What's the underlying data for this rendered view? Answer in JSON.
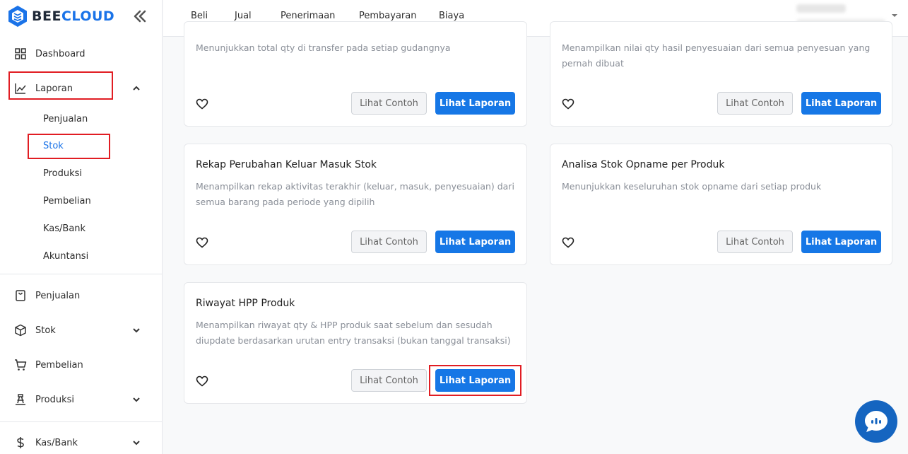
{
  "brand": {
    "name_part1": "BEE",
    "name_part2": "CLOUD"
  },
  "sidebar": {
    "dashboard": "Dashboard",
    "laporan": "Laporan",
    "laporan_sub": [
      "Penjualan",
      "Stok",
      "Produksi",
      "Pembelian",
      "Kas/Bank",
      "Akuntansi"
    ],
    "menu": [
      "Penjualan",
      "Stok",
      "Pembelian",
      "Produksi",
      "Kas/Bank"
    ]
  },
  "topnav": [
    "Beli",
    "Jual",
    "Penerimaan",
    "Pembayaran",
    "Biaya"
  ],
  "cards": [
    {
      "title": "",
      "desc": "Menunjukkan total qty di transfer pada setiap gudangnya"
    },
    {
      "title": "",
      "desc": "Menampilkan nilai qty hasil penyesuaian dari semua penyesuan yang pernah dibuat"
    },
    {
      "title": "Rekap Perubahan Keluar Masuk Stok",
      "desc": "Menampilkan rekap aktivitas terakhir (keluar, masuk, penyesuaian) dari semua barang pada periode yang dipilih"
    },
    {
      "title": "Analisa Stok Opname per Produk",
      "desc": "Menunjukkan keseluruhan stok opname dari setiap produk"
    },
    {
      "title": "Riwayat HPP Produk",
      "desc": "Menampilkan riwayat qty & HPP produk saat sebelum dan sesudah diupdate berdasarkan urutan entry transaksi (bukan tanggal transaksi)"
    }
  ],
  "buttons": {
    "example": "Lihat Contoh",
    "report": "Lihat Laporan"
  },
  "colors": {
    "accent": "#1677e6",
    "highlight": "#e11d23"
  }
}
